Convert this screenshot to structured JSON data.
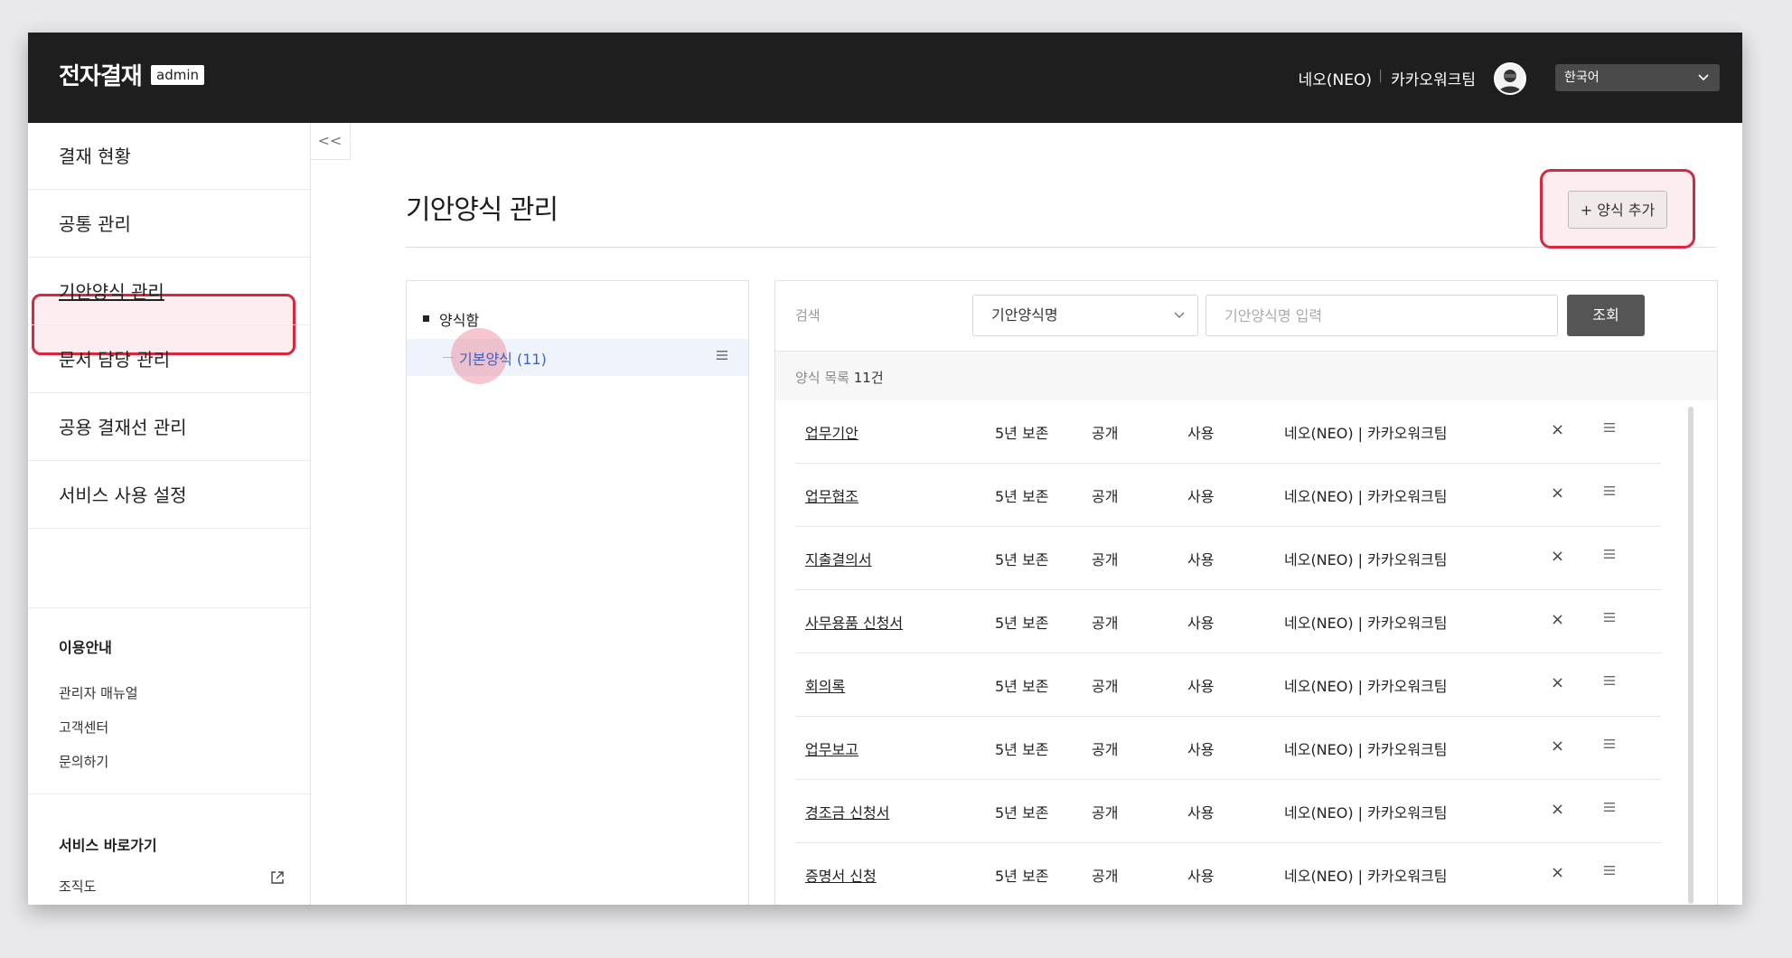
{
  "header": {
    "logo": "전자결재",
    "badge": "admin",
    "user_name": "네오(NEO)",
    "separator": "|",
    "user_org": "카카오워크팀",
    "language": "한국어"
  },
  "sidebar": {
    "collapse_label": "<<",
    "items": [
      {
        "label": "결재 현황"
      },
      {
        "label": "공통 관리"
      },
      {
        "label": "기안양식 관리"
      },
      {
        "label": "문서 담당 관리"
      },
      {
        "label": "공용 결재선 관리"
      },
      {
        "label": "서비스 사용 설정"
      }
    ],
    "guide_title": "이용안내",
    "guide_links": [
      "관리자 매뉴얼",
      "고객센터",
      "문의하기"
    ],
    "shortcut_title": "서비스 바로가기",
    "shortcut_links": [
      "조직도"
    ]
  },
  "page": {
    "title": "기안양식 관리",
    "add_button": "+ 양식 추가"
  },
  "tree": {
    "root_label": "양식함",
    "child_label": "기본양식",
    "child_count": "(11)"
  },
  "search": {
    "label": "검색",
    "field_selected": "기안양식명",
    "input_placeholder": "기안양식명 입력",
    "button": "조회"
  },
  "list": {
    "count_prefix": "양식 목록",
    "count": "11건",
    "rows": [
      {
        "name": "업무기안",
        "retention": "5년 보존",
        "visibility": "공개",
        "status": "사용",
        "owner": "네오(NEO) | 카카오워크팀"
      },
      {
        "name": "업무협조",
        "retention": "5년 보존",
        "visibility": "공개",
        "status": "사용",
        "owner": "네오(NEO) | 카카오워크팀"
      },
      {
        "name": "지출결의서",
        "retention": "5년 보존",
        "visibility": "공개",
        "status": "사용",
        "owner": "네오(NEO) | 카카오워크팀"
      },
      {
        "name": "사무용품 신청서",
        "retention": "5년 보존",
        "visibility": "공개",
        "status": "사용",
        "owner": "네오(NEO) | 카카오워크팀"
      },
      {
        "name": "회의록",
        "retention": "5년 보존",
        "visibility": "공개",
        "status": "사용",
        "owner": "네오(NEO) | 카카오워크팀"
      },
      {
        "name": "업무보고",
        "retention": "5년 보존",
        "visibility": "공개",
        "status": "사용",
        "owner": "네오(NEO) | 카카오워크팀"
      },
      {
        "name": "경조금 신청서",
        "retention": "5년 보존",
        "visibility": "공개",
        "status": "사용",
        "owner": "네오(NEO) | 카카오워크팀"
      },
      {
        "name": "증명서 신청",
        "retention": "5년 보존",
        "visibility": "공개",
        "status": "사용",
        "owner": "네오(NEO) | 카카오워크팀"
      }
    ],
    "delete_glyph": "×"
  },
  "colors": {
    "header_bg": "#1e1e1e",
    "highlight": "#d9273d",
    "link_blue": "#3b62c9"
  }
}
